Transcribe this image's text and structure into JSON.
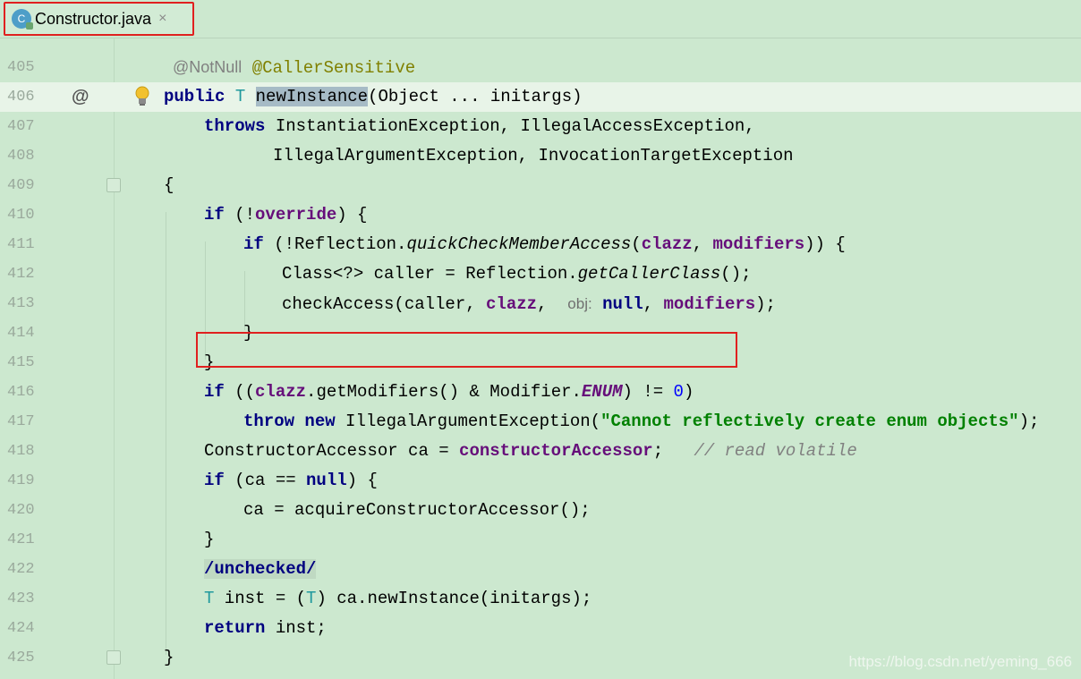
{
  "tab": {
    "icon_letter": "C",
    "label": "Constructor.java",
    "close_glyph": "×"
  },
  "lines": [
    {
      "num": "405"
    },
    {
      "num": "406"
    },
    {
      "num": "407"
    },
    {
      "num": "408"
    },
    {
      "num": "409"
    },
    {
      "num": "410"
    },
    {
      "num": "411"
    },
    {
      "num": "412"
    },
    {
      "num": "413"
    },
    {
      "num": "414"
    },
    {
      "num": "415"
    },
    {
      "num": "416"
    },
    {
      "num": "417"
    },
    {
      "num": "418"
    },
    {
      "num": "419"
    },
    {
      "num": "420"
    },
    {
      "num": "421"
    },
    {
      "num": "422"
    },
    {
      "num": "423"
    },
    {
      "num": "424"
    },
    {
      "num": "425"
    }
  ],
  "code": {
    "l405": {
      "notnull": "@NotNull",
      "caller_sensitive": "@CallerSensitive"
    },
    "l406": {
      "marker": "@",
      "kw_public": "public",
      "type_t": "T",
      "method": "newInstance",
      "params": "(Object ... initargs)"
    },
    "l407": {
      "kw_throws": "throws",
      "rest": " InstantiationException, IllegalAccessException,"
    },
    "l408": {
      "rest": "IllegalArgumentException, InvocationTargetException"
    },
    "l409": {
      "brace": "{"
    },
    "l410": {
      "kw_if": "if",
      "p1": " (!",
      "field": "override",
      "p2": ") {"
    },
    "l411": {
      "kw_if": "if",
      "p1": " (!Reflection.",
      "method": "quickCheckMemberAccess",
      "p2": "(",
      "f1": "clazz",
      "p3": ", ",
      "f2": "modifiers",
      "p4": ")) {"
    },
    "l412": {
      "p1": "Class<?> caller = Reflection.",
      "method": "getCallerClass",
      "p2": "();"
    },
    "l413": {
      "p1": "checkAccess(caller, ",
      "f1": "clazz",
      "p2": ", ",
      "hint": "obj:",
      "null": "null",
      "p3": ", ",
      "f2": "modifiers",
      "p4": ");"
    },
    "l414": {
      "brace": "}"
    },
    "l415": {
      "brace": "}"
    },
    "l416": {
      "kw_if": "if",
      "p1": " ((",
      "f1": "clazz",
      "p2": ".getModifiers() & Modifier.",
      "const": "ENUM",
      "p3": ") != ",
      "num": "0",
      "p4": ")"
    },
    "l417": {
      "kw_throw": "throw",
      "kw_new": "new",
      "p1": " IllegalArgumentException(",
      "str": "\"Cannot reflectively create enum objects\"",
      "p2": ");"
    },
    "l418": {
      "p1": "ConstructorAccessor ca = ",
      "field": "constructorAccessor",
      "p2": ";",
      "comment": "// read volatile"
    },
    "l419": {
      "kw_if": "if",
      "p1": " (ca == ",
      "null": "null",
      "p2": ") {"
    },
    "l420": {
      "p1": "ca = acquireConstructorAccessor();"
    },
    "l421": {
      "brace": "}"
    },
    "l422": {
      "p1": "/unchecked/"
    },
    "l423": {
      "type_t": "T",
      "p1": " inst = (",
      "type_t2": "T",
      "p2": ") ca.newInstance(initargs);"
    },
    "l424": {
      "kw_return": "return",
      "p1": " inst;"
    },
    "l425": {
      "brace": "}"
    }
  },
  "watermark": "https://blog.csdn.net/yeming_666"
}
